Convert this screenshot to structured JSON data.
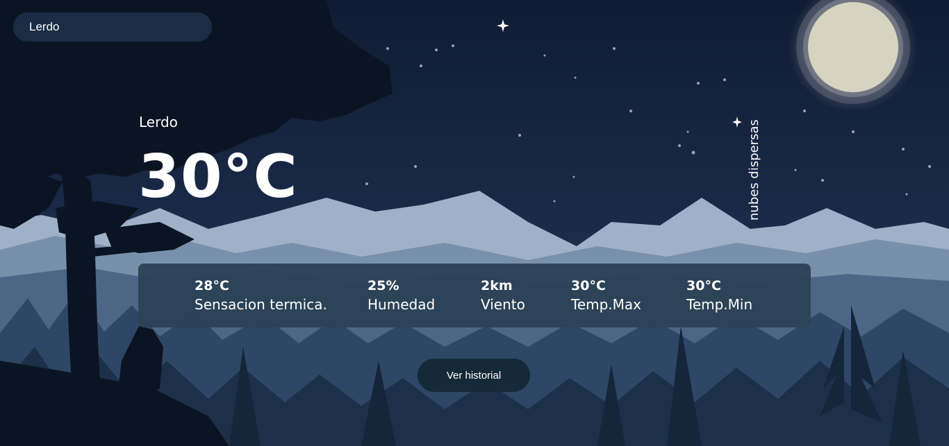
{
  "search": {
    "value": "Lerdo"
  },
  "weather": {
    "city": "Lerdo",
    "temperature": "30°C",
    "description": "nubes dispersas"
  },
  "stats": [
    {
      "value": "28°C",
      "label": "Sensacion termica."
    },
    {
      "value": "25%",
      "label": "Humedad"
    },
    {
      "value": "2km",
      "label": "Viento"
    },
    {
      "value": "30°C",
      "label": "Temp.Max"
    },
    {
      "value": "30°C",
      "label": "Temp.Min"
    }
  ],
  "actions": {
    "history_label": "Ver historial"
  },
  "colors": {
    "sky": "#14213a",
    "moon": "#d6d4c0",
    "panel": "#2c4256",
    "button": "#142a38"
  }
}
